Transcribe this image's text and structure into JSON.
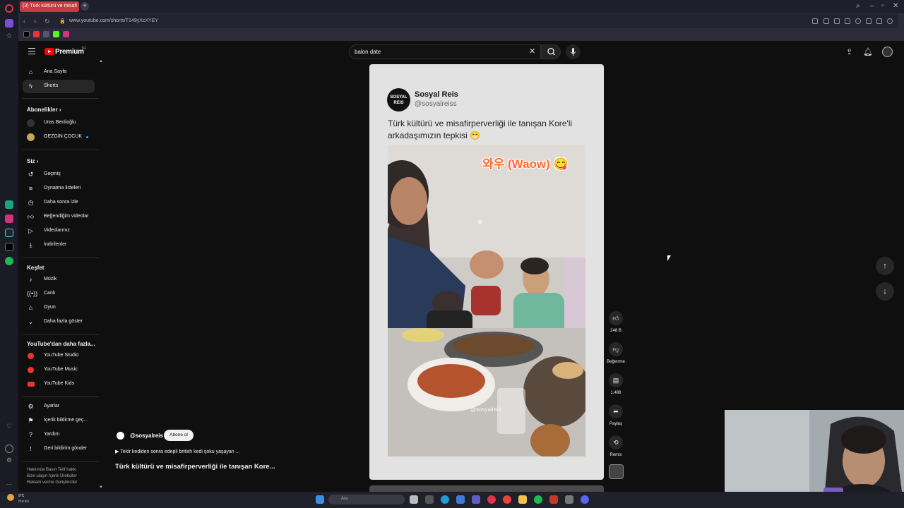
{
  "browser": {
    "tab_title": "(3) Türk kültürü ve misafi",
    "new_tab": "+",
    "url": "www.youtube.com/shorts/T149yXcXYEY",
    "window_controls": [
      "search-icon",
      "minimize-icon",
      "restore-icon",
      "close-icon"
    ]
  },
  "header": {
    "logo_text": "Premium",
    "logo_region": "TR",
    "search_value": "balon date",
    "clear_symbol": "✕"
  },
  "sidebar": {
    "main": [
      {
        "label": "Ana Sayfa",
        "icon": "home-icon"
      },
      {
        "label": "Shorts",
        "icon": "shorts-icon"
      }
    ],
    "subscriptions_title": "Abonelikler",
    "subscriptions": [
      {
        "label": "Uras Benlioğlu"
      },
      {
        "label": "GEZGİN ÇOCUK"
      }
    ],
    "you_title": "Siz",
    "you": [
      {
        "label": "Geçmiş",
        "icon": "history-icon"
      },
      {
        "label": "Oynatma listeleri",
        "icon": "playlist-icon"
      },
      {
        "label": "Daha sonra izle",
        "icon": "clock-icon"
      },
      {
        "label": "Beğendiğim videolar",
        "icon": "thumb-up-icon"
      },
      {
        "label": "Videolarınız",
        "icon": "video-icon"
      },
      {
        "label": "İndirilenler",
        "icon": "download-icon"
      }
    ],
    "explore_title": "Keşfet",
    "explore": [
      {
        "label": "Müzik",
        "icon": "music-icon"
      },
      {
        "label": "Canlı",
        "icon": "live-icon"
      },
      {
        "label": "Oyun",
        "icon": "gamepad-icon"
      },
      {
        "label": "Daha fazla göster",
        "icon": "chevron-down-icon"
      }
    ],
    "more_title": "YouTube'dan daha fazla...",
    "more": [
      {
        "label": "YouTube Studio"
      },
      {
        "label": "YouTube Music"
      },
      {
        "label": "YouTube Kids"
      }
    ],
    "settings": [
      {
        "label": "Ayarlar",
        "icon": "gear-icon"
      },
      {
        "label": "İçerik bildirme geç...",
        "icon": "flag-icon"
      },
      {
        "label": "Yardım",
        "icon": "help-icon"
      },
      {
        "label": "Geri bildirim gönder",
        "icon": "feedback-icon"
      }
    ],
    "footer_line1": "Hakkında  Basın  Telif hakkı",
    "footer_line2": "Bize ulaşın  İçerik Üreticiler",
    "footer_line3": "Reklam verme  Geliştiriciler"
  },
  "short": {
    "post_name": "Sosyal Reis",
    "post_handle": "@sosyalreiss",
    "post_text": "Türk kültürü ve misafirperverliği ile tanışan Kore'li arkadaşımızın tepkisi 😁",
    "overlay_text": "와우 (Waow) 😋",
    "watermark": "@sosyalreis",
    "avatar_text": "SOSYAL REIS",
    "channel": "@sosyalreis",
    "subscribe_label": "Abone ol",
    "music_line": "▶  Tekir kediden sonra edepli british kedi şoku yaşayan ...",
    "title": "Türk kültürü ve misafirperverliği ile tanışan Kore..."
  },
  "actions": {
    "like_count": "248 B",
    "dislike_label": "Beğenme",
    "comment_count": "1.486",
    "share_label": "Paylaş",
    "remix_label": "Remix"
  },
  "taskbar": {
    "weather_temp": "9°C",
    "weather_desc": "Bulutlu",
    "search_label": "Ara"
  },
  "colors": {
    "yt_red": "#ff0000",
    "background": "#0f0f0f",
    "tab_active": "#c73b45"
  }
}
